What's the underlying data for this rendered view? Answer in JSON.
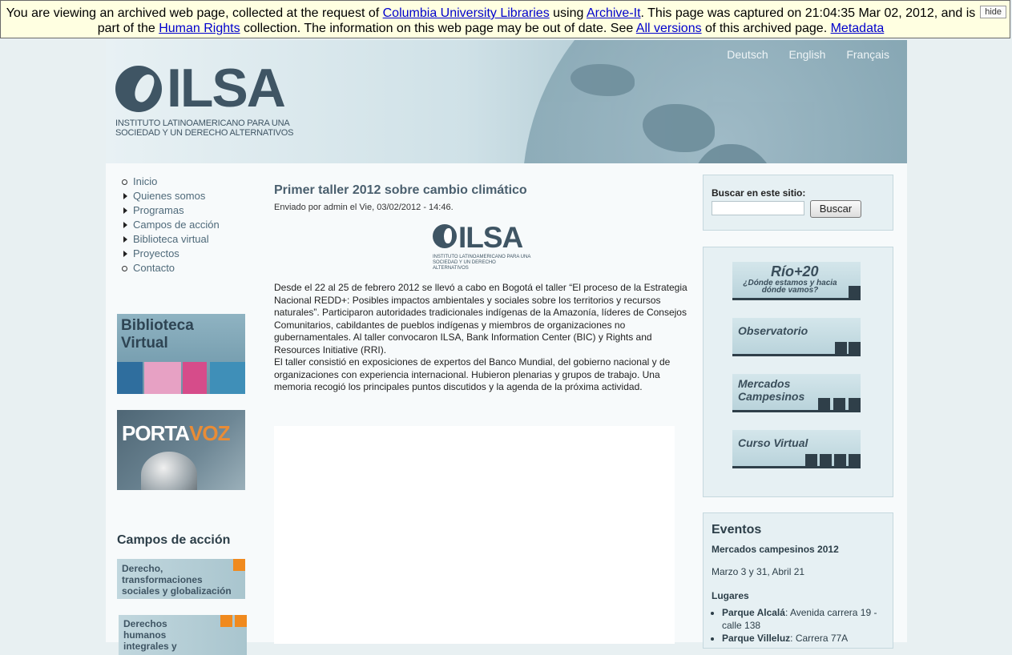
{
  "archive_banner": {
    "t1": "You are viewing an archived web page, collected at the request of ",
    "link_cul": "Columbia University Libraries",
    "t2": " using ",
    "link_ait": "Archive-It",
    "t3": ". This page was captured on 21:04:35 Mar 02, 2012, and is part of the ",
    "link_hr": "Human Rights",
    "t4": " collection. The information on this web page may be out of date. See ",
    "link_versions": "All versions",
    "t5": " of this archived page. ",
    "link_meta": "Metadata",
    "hide": "hide"
  },
  "header": {
    "logo": "ILSA",
    "logo_sub": "INSTITUTO LATINOAMERICANO PARA UNA SOCIEDAD Y UN DERECHO ALTERNATIVOS",
    "languages": [
      "Deutsch",
      "English",
      "Français"
    ]
  },
  "nav": {
    "items": [
      "Inicio",
      "Quienes somos",
      "Programas",
      "Campos de acción",
      "Biblioteca virtual",
      "Proyectos",
      "Contacto"
    ]
  },
  "promos": {
    "biblio": "Biblioteca Virtual",
    "portavoz_a": "PORTA",
    "portavoz_b": "VOZ"
  },
  "campos": {
    "heading": "Campos de acción",
    "items": [
      "Derecho, transformaciones sociales y globalización",
      "Derechos humanos integrales y"
    ]
  },
  "post": {
    "title": "Primer taller 2012 sobre cambio climático",
    "meta": "Enviado por admin el Vie, 03/02/2012 - 14:46.",
    "logo": "ILSA",
    "logo_sub": "INSTITUTO LATINOAMERICANO PARA UNA SOCIEDAD Y UN DERECHO ALTERNATIVOS",
    "p1": "Desde el 22 al 25 de febrero 2012 se llevó a cabo en Bogotá el taller “El proceso de la Estrategia Nacional REDD+: Posibles impactos ambientales y sociales sobre los territorios y recursos naturales”. Participaron autoridades tradicionales indígenas de la Amazonía, líderes de Consejos Comunitarios, cabildantes de pueblos indígenas y miembros de organizaciones no gubernamentales. Al taller convocaron ILSA, Bank Information Center (BIC) y Rights and Resources Initiative (RRI).",
    "p2": "El taller consistió en exposiciones de expertos del Banco Mundial, del gobierno nacional y de organizaciones con experiencia internacional. Hubieron plenarias y grupos de trabajo. Una memoria recogió los principales puntos discutidos y la agenda de la próxima actividad."
  },
  "search": {
    "label": "Buscar en este sitio:",
    "button": "Buscar"
  },
  "links": {
    "rio": "Río+20",
    "rio_sub": "¿Dónde estamos y hacia dónde vamos?",
    "observatorio": "Observatorio",
    "mercados": "Mercados Campesinos",
    "curso": "Curso Virtual"
  },
  "eventos": {
    "heading": "Eventos",
    "title": "Mercados campesinos 2012",
    "date": "Marzo 3 y 31, Abril 21",
    "lugares_heading": "Lugares",
    "lugares": [
      {
        "name": "Parque Alcalá",
        "addr": ": Avenida carrera 19 - calle 138"
      },
      {
        "name": "Parque Villeluz",
        "addr": ": Carrera 77A"
      }
    ]
  }
}
